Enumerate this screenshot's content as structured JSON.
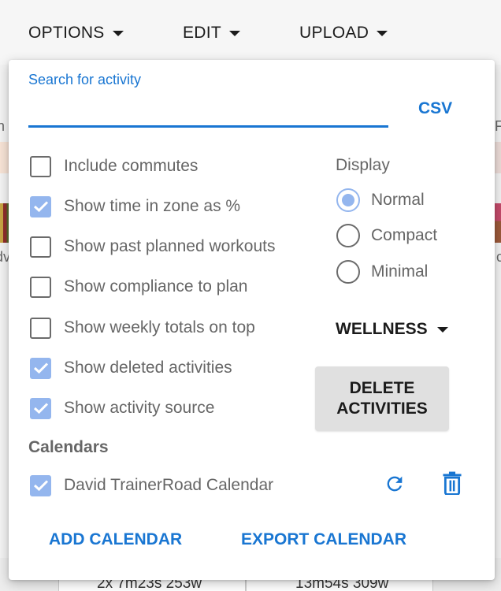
{
  "topbar": {
    "options_label": "OPTIONS",
    "edit_label": "EDIT",
    "upload_label": "UPLOAD"
  },
  "background": {
    "left_fragments": [
      "n",
      "dv"
    ],
    "right_fragments": [
      "F",
      "c"
    ],
    "bottom_cells": [
      "2x 7m23s 253w",
      "13m54s 309w"
    ]
  },
  "panel": {
    "search": {
      "label": "Search for activity",
      "value": "",
      "placeholder": ""
    },
    "csv_label": "CSV",
    "options": [
      {
        "label": "Include commutes",
        "checked": false
      },
      {
        "label": "Show time in zone as %",
        "checked": true
      },
      {
        "label": "Show past planned workouts",
        "checked": false
      },
      {
        "label": "Show compliance to plan",
        "checked": false
      },
      {
        "label": "Show weekly totals on top",
        "checked": false
      },
      {
        "label": "Show deleted activities",
        "checked": true
      },
      {
        "label": "Show activity source",
        "checked": true
      }
    ],
    "display": {
      "title": "Display",
      "options": [
        {
          "label": "Normal",
          "selected": true
        },
        {
          "label": "Compact",
          "selected": false
        },
        {
          "label": "Minimal",
          "selected": false
        }
      ]
    },
    "wellness_label": "WELLNESS",
    "delete_line1": "DELETE",
    "delete_line2": "ACTIVITIES",
    "calendars": {
      "title": "Calendars",
      "items": [
        {
          "label": "David TrainerRoad Calendar",
          "checked": true
        }
      ]
    },
    "add_calendar_label": "ADD CALENDAR",
    "export_calendar_label": "EXPORT CALENDAR"
  },
  "colors": {
    "accent": "#1976d2",
    "checked_fill": "#94b6ee",
    "text_gray": "#666666",
    "button_gray": "#e0e0e0"
  },
  "icons": {
    "refresh": "refresh-icon",
    "trash": "trash-icon",
    "caret": "caret-down-icon",
    "check": "checkmark-icon"
  }
}
